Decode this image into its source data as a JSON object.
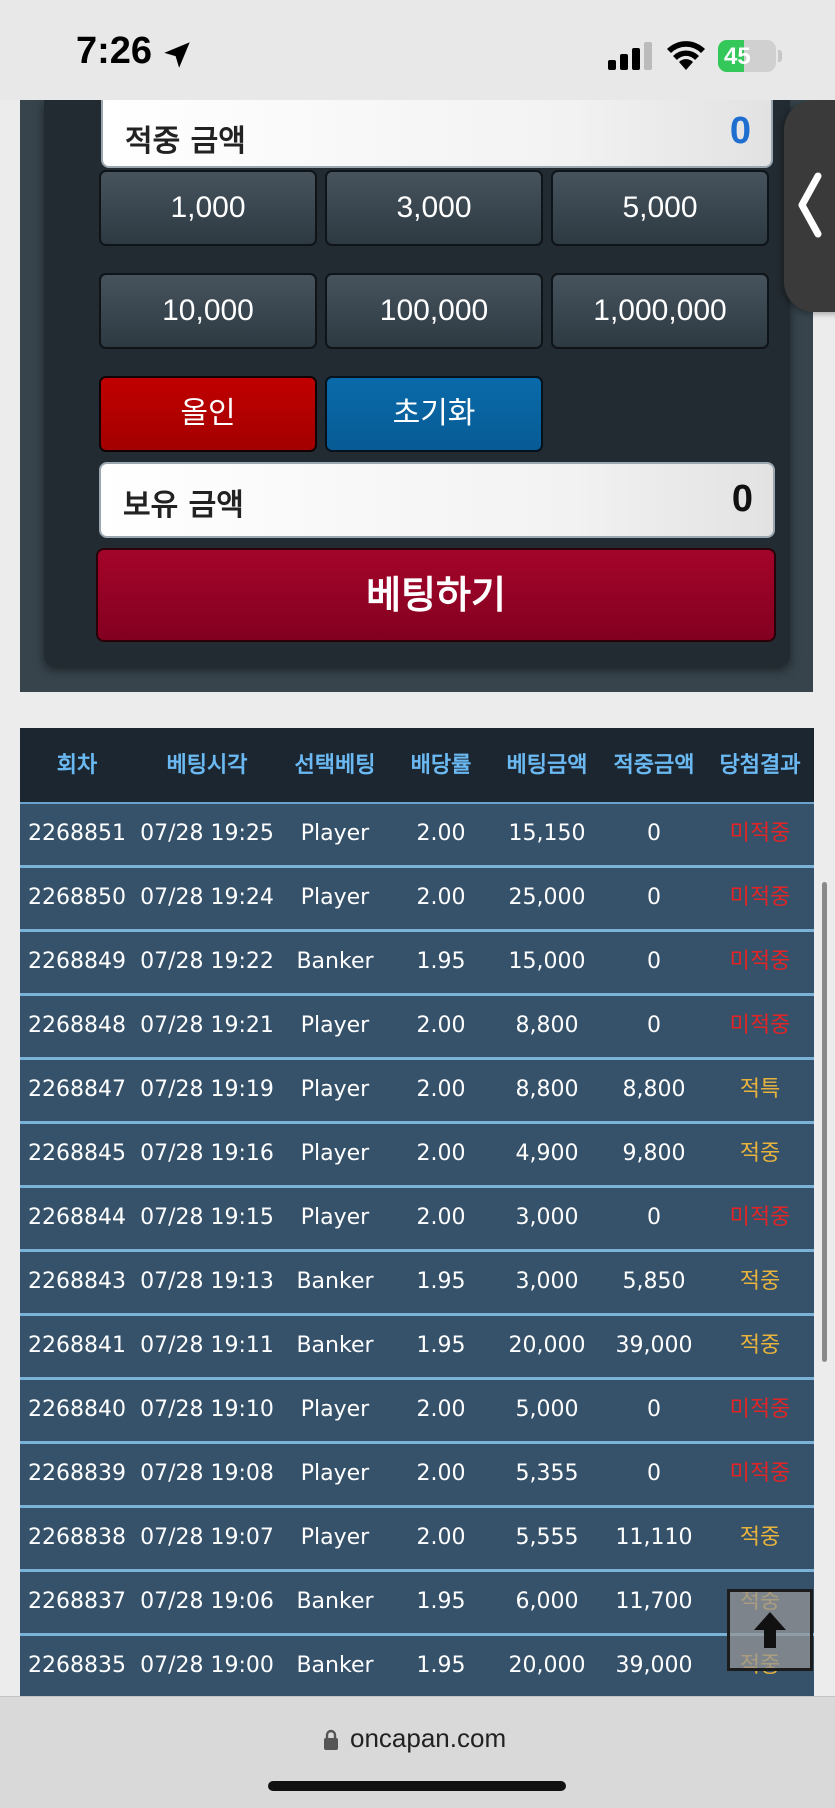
{
  "status_bar": {
    "time": "7:26",
    "battery": "45",
    "battery_level": 0.45
  },
  "bet_panel": {
    "hit_amount_label": "적중 금액",
    "hit_amount_value": "0",
    "chips": [
      "1,000",
      "3,000",
      "5,000",
      "10,000",
      "100,000",
      "1,000,000"
    ],
    "allin_label": "올인",
    "reset_label": "초기화",
    "balance_label": "보유 금액",
    "balance_value": "0",
    "bet_button_label": "베팅하기"
  },
  "history": {
    "headers": [
      "회차",
      "베팅시각",
      "선택베팅",
      "배당률",
      "베팅금액",
      "적중금액",
      "당첨결과"
    ],
    "rows": [
      [
        "2268851",
        "07/28 19:25",
        "Player",
        "2.00",
        "15,150",
        "0",
        "미적중"
      ],
      [
        "2268850",
        "07/28 19:24",
        "Player",
        "2.00",
        "25,000",
        "0",
        "미적중"
      ],
      [
        "2268849",
        "07/28 19:22",
        "Banker",
        "1.95",
        "15,000",
        "0",
        "미적중"
      ],
      [
        "2268848",
        "07/28 19:21",
        "Player",
        "2.00",
        "8,800",
        "0",
        "미적중"
      ],
      [
        "2268847",
        "07/28 19:19",
        "Player",
        "2.00",
        "8,800",
        "8,800",
        "적특"
      ],
      [
        "2268845",
        "07/28 19:16",
        "Player",
        "2.00",
        "4,900",
        "9,800",
        "적중"
      ],
      [
        "2268844",
        "07/28 19:15",
        "Player",
        "2.00",
        "3,000",
        "0",
        "미적중"
      ],
      [
        "2268843",
        "07/28 19:13",
        "Banker",
        "1.95",
        "3,000",
        "5,850",
        "적중"
      ],
      [
        "2268841",
        "07/28 19:11",
        "Banker",
        "1.95",
        "20,000",
        "39,000",
        "적중"
      ],
      [
        "2268840",
        "07/28 19:10",
        "Player",
        "2.00",
        "5,000",
        "0",
        "미적중"
      ],
      [
        "2268839",
        "07/28 19:08",
        "Player",
        "2.00",
        "5,355",
        "0",
        "미적중"
      ],
      [
        "2268838",
        "07/28 19:07",
        "Player",
        "2.00",
        "5,555",
        "11,110",
        "적중"
      ],
      [
        "2268837",
        "07/28 19:06",
        "Banker",
        "1.95",
        "6,000",
        "11,700",
        "적중"
      ],
      [
        "2268835",
        "07/28 19:00",
        "Banker",
        "1.95",
        "20,000",
        "39,000",
        "적중"
      ]
    ]
  },
  "browser": {
    "url": "oncapan.com"
  },
  "colors": {
    "win": "#e8b33c",
    "lose": "#e32424",
    "header_text": "#6ab9f2"
  },
  "icons": {
    "location": "location-arrow-icon",
    "signal": "cellular-signal-icon",
    "wifi": "wifi-icon",
    "side_tab": "chevron-left-icon",
    "scroll_top": "arrow-up-icon",
    "lock": "lock-icon"
  }
}
